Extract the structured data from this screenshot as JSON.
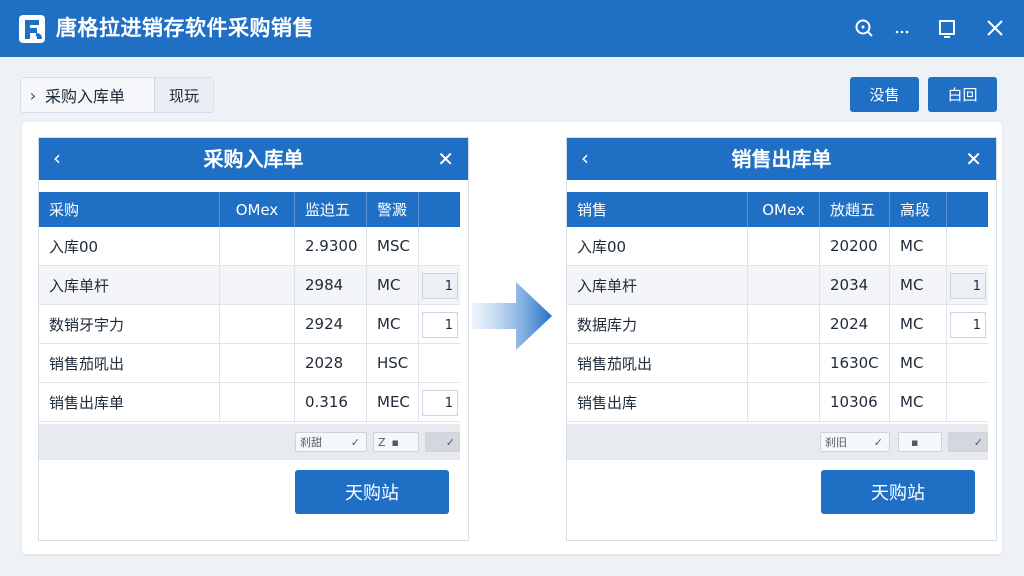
{
  "app": {
    "title": "唐格拉进销存软件采购销售"
  },
  "breadcrumb": {
    "item": "采购入库单",
    "tab": "现玩"
  },
  "toolbar": {
    "btn1": "没售",
    "btn2": "白回"
  },
  "colors": {
    "primary": "#1f6fc5",
    "header_text": "#ffffff"
  },
  "cards": [
    {
      "title": "采购入库单",
      "columns": [
        "采购",
        "OMex",
        "监迫五",
        "警澱"
      ],
      "rows": [
        {
          "name": "入库00",
          "c2": "",
          "c3": "2.9300",
          "c4": "MSC",
          "qty": ""
        },
        {
          "name": "入库单杆",
          "c2": "",
          "c3": "2984",
          "c4": "MC",
          "qty": "1"
        },
        {
          "name": "数销牙宇力",
          "c2": "",
          "c3": "2924",
          "c4": "MC",
          "qty": "1"
        },
        {
          "name": "销售茄吼出",
          "c2": "",
          "c3": "2028",
          "c4": "HSC",
          "qty": ""
        },
        {
          "name": "销售出库单",
          "c2": "",
          "c3": "0.316",
          "c4": "MEC",
          "qty": "1"
        }
      ],
      "footer": {
        "a": "刹甜",
        "b": "Z",
        "c": ""
      },
      "action": "天购站"
    },
    {
      "title": "销售出库单",
      "columns": [
        "销售",
        "OMex",
        "放趙五",
        "高段"
      ],
      "rows": [
        {
          "name": "入库00",
          "c2": "",
          "c3": "20200",
          "c4": "MC",
          "qty": ""
        },
        {
          "name": "入库单杆",
          "c2": "",
          "c3": "2034",
          "c4": "MC",
          "qty": "1"
        },
        {
          "name": "数据库力",
          "c2": "",
          "c3": "2024",
          "c4": "MC",
          "qty": "1"
        },
        {
          "name": "销售茄吼出",
          "c2": "",
          "c3": "1630C",
          "c4": "MC",
          "qty": ""
        },
        {
          "name": "销售出库",
          "c2": "",
          "c3": "10306",
          "c4": "MC",
          "qty": ""
        }
      ],
      "footer": {
        "a": "刹旧",
        "b": "",
        "c": ""
      },
      "action": "天购站"
    }
  ]
}
